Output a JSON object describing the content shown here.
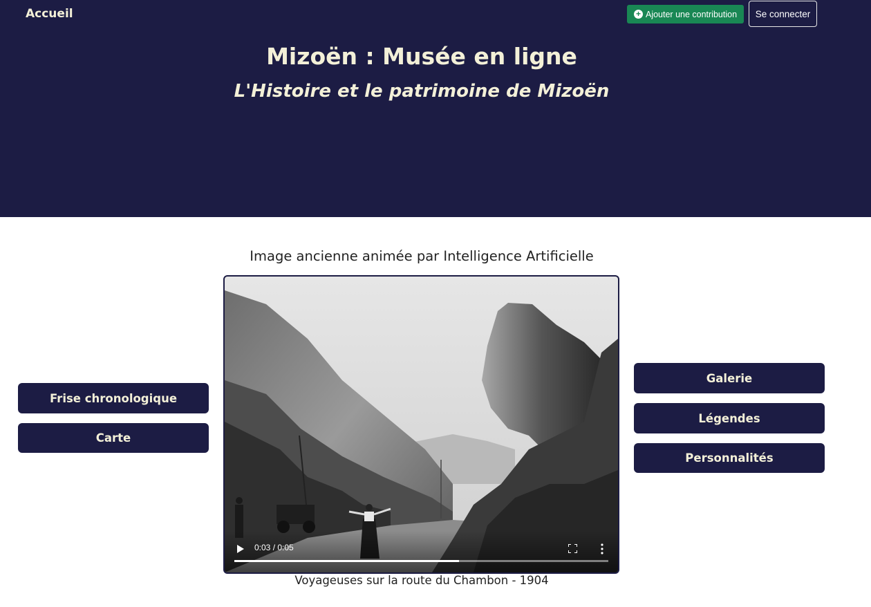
{
  "header": {
    "home_label": "Accueil",
    "contribute_label": "Ajouter une contribution",
    "login_label": "Se connecter",
    "title": "Mizoën : Musée en ligne",
    "subtitle": "L'Histoire et le patrimoine de Mizoën",
    "colors": {
      "background": "#1c1c44",
      "text": "#f3f0d8",
      "contribute": "#198754"
    }
  },
  "main": {
    "section_title": "Image ancienne animée par Intelligence Artificielle",
    "left_buttons": [
      "Frise chronologique",
      "Carte"
    ],
    "right_buttons": [
      "Galerie",
      "Légendes",
      "Personnalités"
    ],
    "video": {
      "time_display": "0:03 / 0:05",
      "progress": 0.6,
      "caption": "Voyageuses sur la route du Chambon - 1904"
    }
  }
}
